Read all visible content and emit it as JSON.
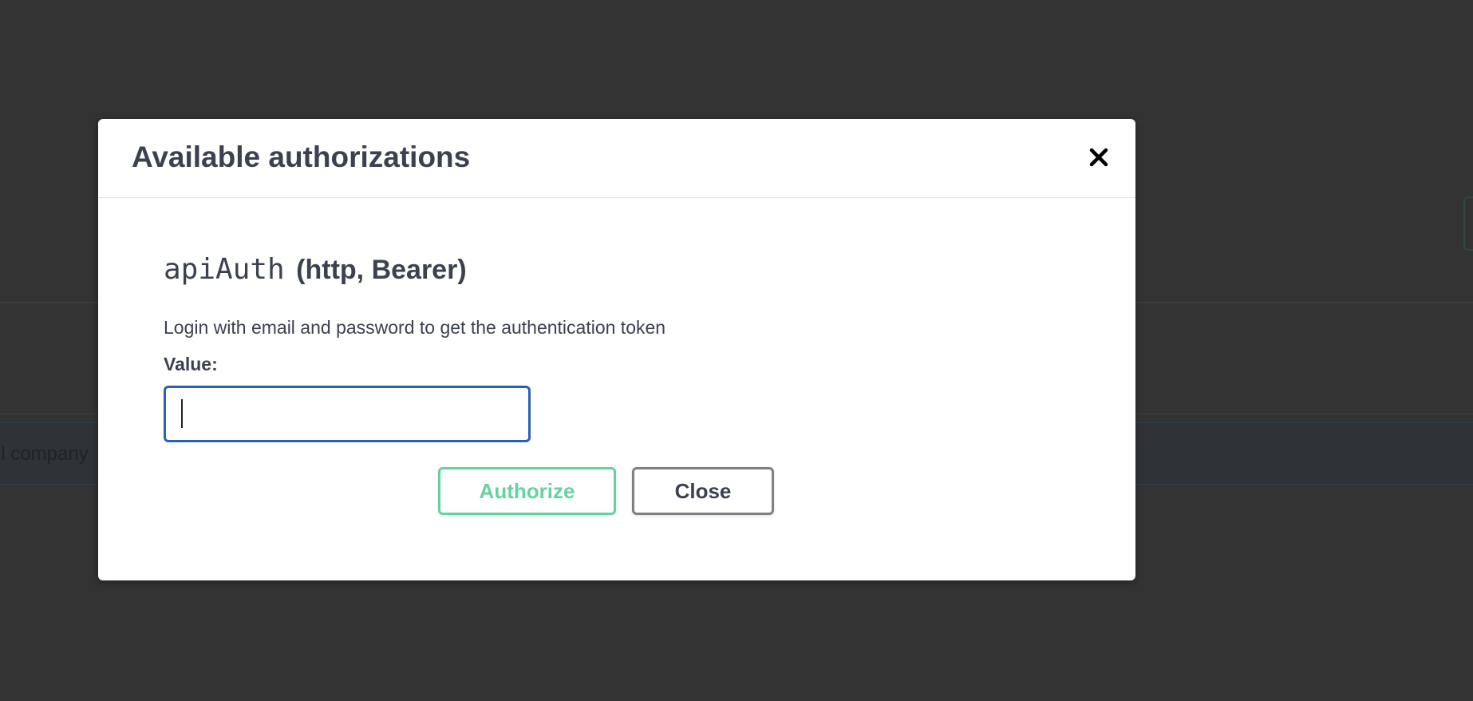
{
  "background": {
    "row_text": "ll company"
  },
  "modal": {
    "title": "Available authorizations",
    "close_icon": "close-icon",
    "auth": {
      "name": "apiAuth",
      "type": "(http, Bearer)",
      "description": "Login with email and password to get the authentication token",
      "value_label": "Value:",
      "value": "",
      "placeholder": ""
    },
    "buttons": {
      "authorize": "Authorize",
      "close": "Close"
    }
  },
  "colors": {
    "overlay": "#333333",
    "text": "#3b4151",
    "authorize_green": "#49cc90",
    "input_focus_border": "#2b5fb8",
    "close_border": "#808080"
  }
}
